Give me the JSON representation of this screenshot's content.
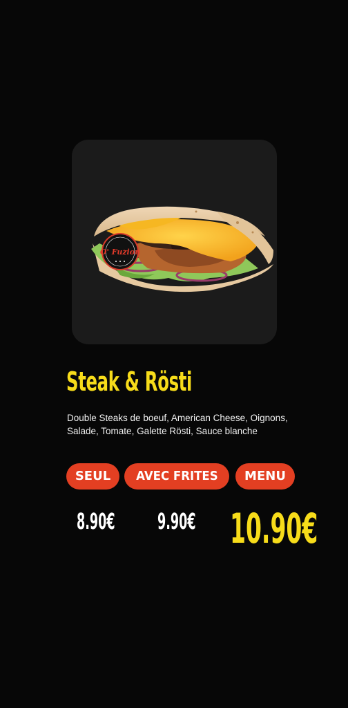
{
  "product": {
    "image_icon": "wrap-sandwich-photo",
    "logo_text": "O' Fuzion",
    "name": "Steak & Rösti",
    "description": "Double Steaks de boeuf, American Cheese, Oignons, Salade, Tomate, Galette Rösti, Sauce blanche"
  },
  "options": [
    {
      "label": "SEUL",
      "price": "8.90€"
    },
    {
      "label": "AVEC FRITES",
      "price": "9.90€"
    },
    {
      "label": "MENU",
      "price": "10.90€"
    }
  ],
  "colors": {
    "background": "#070707",
    "card": "#1b1b1b",
    "accent_yellow": "#f7dc1a",
    "pill_red": "#e33f22",
    "text_white": "#ffffff"
  }
}
